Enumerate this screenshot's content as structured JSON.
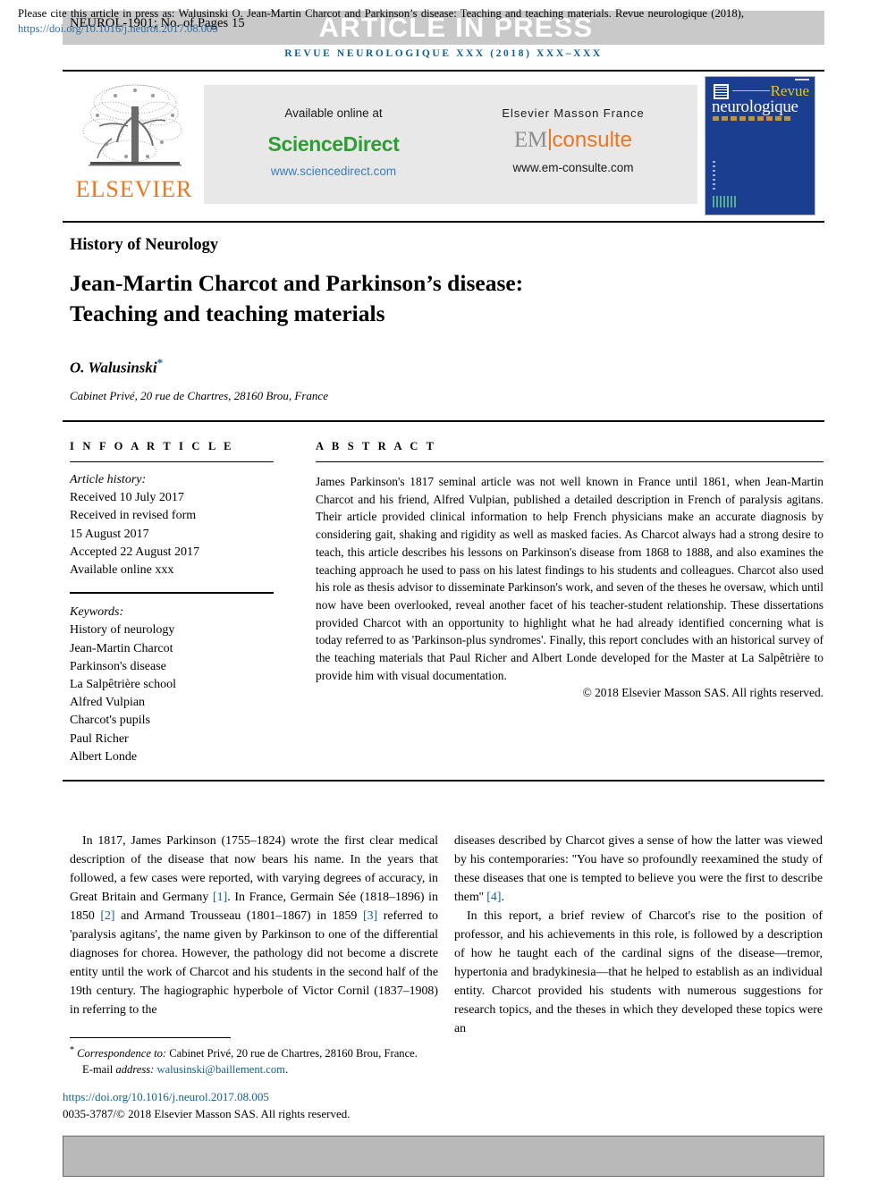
{
  "header": {
    "article_id": "NEUROL-1901; No. of Pages 15",
    "banner": "ARTICLE IN PRESS",
    "journal_running_head": "REVUE NEUROLOGIQUE XXX (2018) XXX–XXX"
  },
  "masthead": {
    "elsevier_wordmark": "ELSEVIER",
    "available_online_at": "Available online at",
    "sciencedirect_logo": "ScienceDirect",
    "sciencedirect_url": "www.sciencedirect.com",
    "elsevier_masson_france": "Elsevier Masson France",
    "em_logo_left": "EM",
    "em_logo_right": "consulte",
    "emconsulte_url": "www.em-consulte.com",
    "cover": {
      "title_line1": "Revue",
      "title_line2": "neurologique"
    }
  },
  "article": {
    "section_label": "History of Neurology",
    "title_line1": "Jean-Martin Charcot and Parkinson’s disease:",
    "title_line2": "Teaching and teaching materials",
    "author": "O. Walusinski",
    "author_marker": "*",
    "affiliation": "Cabinet Privé, 20 rue de Chartres, 28160 Brou, France"
  },
  "info": {
    "heading": "I N F O   A R T I C L E",
    "history_label": "Article history:",
    "history": [
      "Received 10 July 2017",
      "Received in revised form",
      "15 August 2017",
      "Accepted 22 August 2017",
      "Available online xxx"
    ],
    "keywords_label": "Keywords:",
    "keywords": [
      "History of neurology",
      "Jean-Martin Charcot",
      "Parkinson's disease",
      "La Salpêtrière school",
      "Alfred Vulpian",
      "Charcot's pupils",
      "Paul Richer",
      "Albert Londe"
    ]
  },
  "abstract": {
    "heading": "A B S T R A C T",
    "text": "James Parkinson's 1817 seminal article was not well known in France until 1861, when Jean-Martin Charcot and his friend, Alfred Vulpian, published a detailed description in French of paralysis agitans. Their article provided clinical information to help French physicians make an accurate diagnosis by considering gait, shaking and rigidity as well as masked facies. As Charcot always had a strong desire to teach, this article describes his lessons on Parkinson's disease from 1868 to 1888, and also examines the teaching approach he used to pass on his latest findings to his students and colleagues. Charcot also used his role as thesis advisor to disseminate Parkinson's work, and seven of the theses he oversaw, which until now have been overlooked, reveal another facet of his teacher-student relationship. These dissertations provided Charcot with an opportunity to highlight what he had already identified concerning what is today referred to as 'Parkinson-plus syndromes'. Finally, this report concludes with an historical survey of the teaching materials that Paul Richer and Albert Londe developed for the Master at La Salpêtrière to provide him with visual documentation.",
    "copyright": "© 2018 Elsevier Masson SAS. All rights reserved."
  },
  "body": {
    "left_part1": "In 1817, James Parkinson (1755–1824) wrote the first clear medical description of the disease that now bears his name. In the years that followed, a few cases were reported, with varying degrees of accuracy, in Great Britain and Germany ",
    "ref1": "[1]",
    "left_part2": ". In France, Germain Sée (1818–1896) in 1850 ",
    "ref2": "[2]",
    "left_part3": " and Armand Trousseau (1801–1867) in 1859 ",
    "ref3": "[3]",
    "left_part4": " referred to 'paralysis agitans', the name given by Parkinson to one of the differential diagnoses for chorea. However, the pathology did not become a discrete entity until the work of Charcot and his students in the second half of the 19th century. The hagiographic hyperbole of Victor Cornil (1837–1908) in referring to the",
    "right_part1": "diseases described by Charcot gives a sense of how the latter was viewed by his contemporaries: ''You have so profoundly reexamined the study of these diseases that one is tempted to believe you were the first to describe them'' ",
    "ref4": "[4]",
    "right_part2": ".",
    "right_para2": "In this report, a brief review of Charcot's rise to the position of professor, and his achievements in this role, is followed by a description of how he taught each of the cardinal signs of the disease—tremor, hypertonia and bradykinesia—that he helped to establish as an individual entity. Charcot provided his students with numerous suggestions for research topics, and the theses in which they developed these topics were an"
  },
  "footnotes": {
    "correspondence_marker": "*",
    "correspondence_label": "Correspondence to:",
    "correspondence_text": " Cabinet Privé, 20 rue de Chartres, 28160 Brou, France.",
    "email_label": "E-mail address:",
    "email": "walusinski@baillement.com",
    "doi": "https://doi.org/10.1016/j.neurol.2017.08.005",
    "issn_copyright": "0035-3787/© 2018 Elsevier Masson SAS. All rights reserved."
  },
  "cite_box": {
    "text_before_link": "Please cite this article in press as: Walusinski O. Jean-Martin Charcot and Parkinson’s disease: Teaching and teaching materials. Revue neurologique (2018), ",
    "link": "https://doi.org/10.1016/j.neurol.2017.08.005"
  },
  "colors": {
    "accent_blue": "#11618f",
    "link_blue": "#2e6ea8",
    "elsevier_orange": "#e87722",
    "sciencedirect_green": "#2e9e34",
    "banner_gray": "#c9c9c9",
    "panel_gray": "#e8e8e8",
    "cite_gray": "#b9b9b9",
    "cover_blue": "#1b3e91"
  }
}
